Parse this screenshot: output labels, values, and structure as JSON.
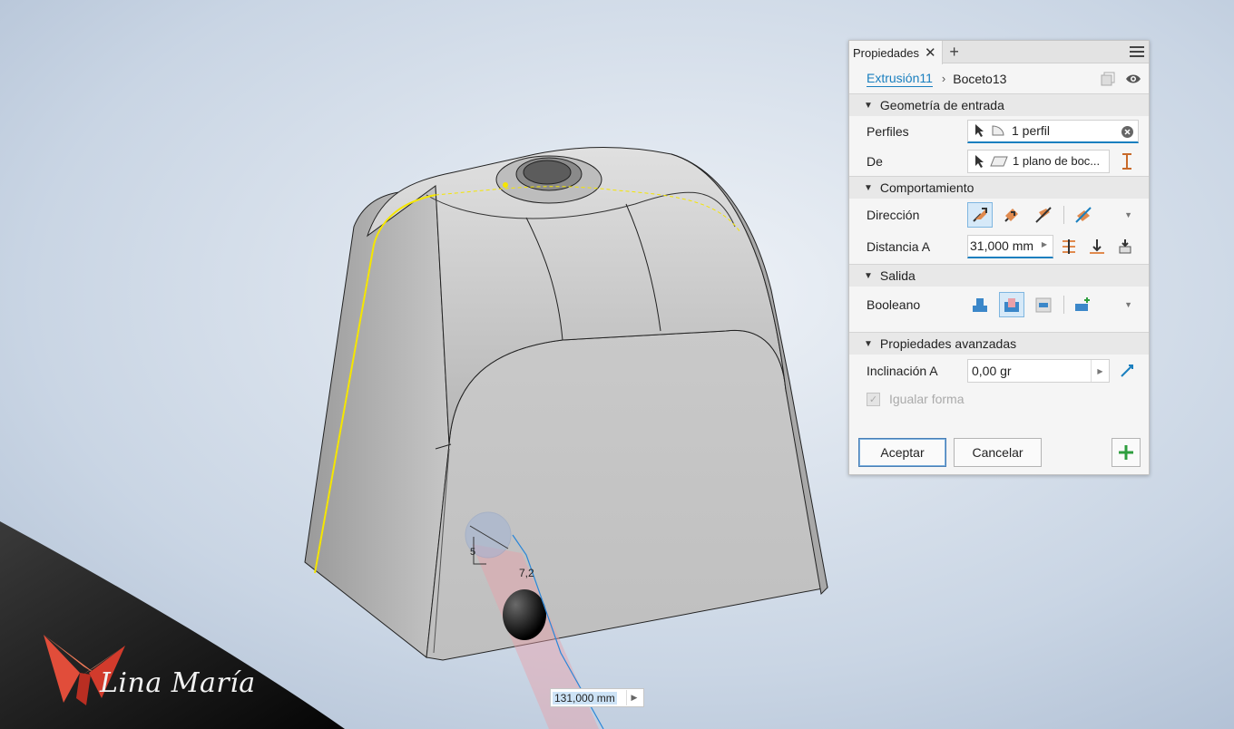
{
  "panel": {
    "tab_label": "Propiedades",
    "breadcrumb": {
      "feature": "Extrusión11",
      "sketch": "Boceto13"
    },
    "sections": {
      "input_geometry": "Geometría de entrada",
      "behavior": "Comportamiento",
      "output": "Salida",
      "advanced": "Propiedades avanzadas"
    },
    "profiles": {
      "label": "Perfiles",
      "value": "1 perfil"
    },
    "from": {
      "label": "De",
      "value": "1 plano de boc..."
    },
    "direction": {
      "label": "Dirección"
    },
    "distance": {
      "label": "Distancia A",
      "value": "31,000 mm"
    },
    "boolean": {
      "label": "Booleano"
    },
    "taper": {
      "label": "Inclinación A",
      "value": "0,00 gr"
    },
    "match_shape": {
      "label": "Igualar forma"
    },
    "buttons": {
      "ok": "Aceptar",
      "cancel": "Cancelar"
    }
  },
  "viewport": {
    "dimension_value": "131,000 mm",
    "sketch_dim_1": "5",
    "sketch_dim_2": "7,2"
  },
  "watermark": {
    "text": "Lina María"
  },
  "colors": {
    "accent": "#1a7fbf",
    "highlight": "#f5e600",
    "add_green": "#2e9e3e",
    "orange": "#e08a4e"
  }
}
